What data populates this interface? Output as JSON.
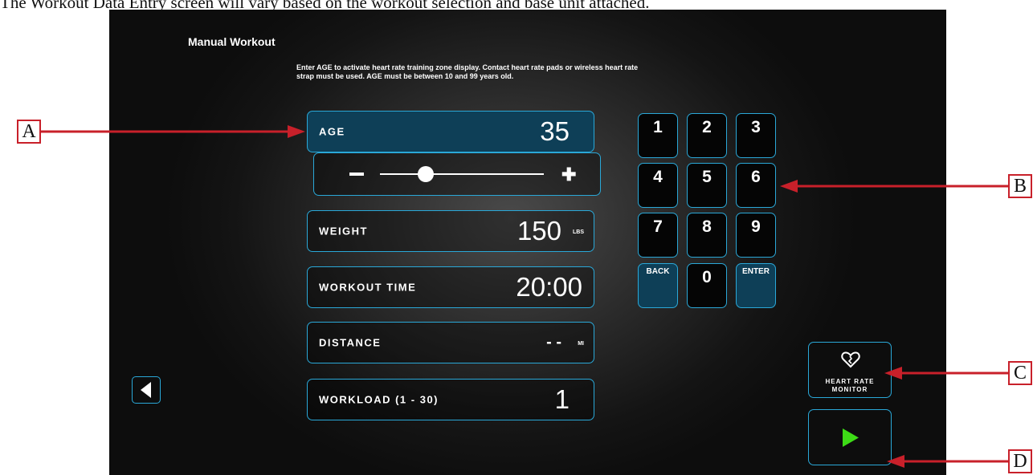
{
  "caption": "The Workout Data Entry screen will vary based on the workout selection and base unit attached.",
  "title": "Manual Workout",
  "instruction": "Enter AGE to activate heart rate training zone display.  Contact heart rate pads or wireless heart rate strap must be used. AGE must be between 10 and 99 years old.",
  "fields": {
    "age": {
      "label": "AGE",
      "value": "35"
    },
    "weight": {
      "label": "WEIGHT",
      "value": "150",
      "unit": "LBS"
    },
    "time": {
      "label": "WORKOUT TIME",
      "value": "20:00"
    },
    "distance": {
      "label": "DISTANCE",
      "value": "- -",
      "unit": "MI"
    },
    "workload": {
      "label": "WORKLOAD (1 - 30)",
      "value": "1"
    }
  },
  "age_slider": {
    "min": 10,
    "max": 99,
    "value": 35
  },
  "keypad": {
    "k1": "1",
    "k2": "2",
    "k3": "3",
    "k4": "4",
    "k5": "5",
    "k6": "6",
    "k7": "7",
    "k8": "8",
    "k9": "9",
    "back": "BACK",
    "k0": "0",
    "enter": "ENTER"
  },
  "heart_rate": {
    "label_line1": "HEART RATE",
    "label_line2": "MONITOR",
    "icon": "heart-icon"
  },
  "callouts": {
    "a": "A",
    "b": "B",
    "c": "C",
    "d": "D"
  },
  "colors": {
    "accent": "#2aa8d8",
    "active_field": "#0e3f57",
    "play": "#3ddc16",
    "callout": "#c8202a"
  }
}
